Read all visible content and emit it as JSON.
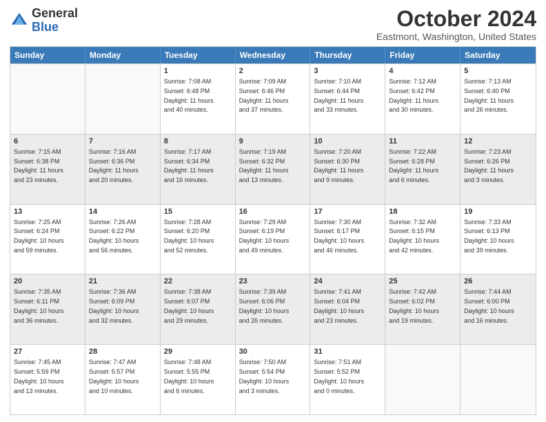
{
  "header": {
    "logo_general": "General",
    "logo_blue": "Blue",
    "title": "October 2024",
    "subtitle": "Eastmont, Washington, United States"
  },
  "days_of_week": [
    "Sunday",
    "Monday",
    "Tuesday",
    "Wednesday",
    "Thursday",
    "Friday",
    "Saturday"
  ],
  "weeks": [
    [
      {
        "day": "",
        "lines": []
      },
      {
        "day": "",
        "lines": []
      },
      {
        "day": "1",
        "lines": [
          "Sunrise: 7:08 AM",
          "Sunset: 6:48 PM",
          "Daylight: 11 hours",
          "and 40 minutes."
        ]
      },
      {
        "day": "2",
        "lines": [
          "Sunrise: 7:09 AM",
          "Sunset: 6:46 PM",
          "Daylight: 11 hours",
          "and 37 minutes."
        ]
      },
      {
        "day": "3",
        "lines": [
          "Sunrise: 7:10 AM",
          "Sunset: 6:44 PM",
          "Daylight: 11 hours",
          "and 33 minutes."
        ]
      },
      {
        "day": "4",
        "lines": [
          "Sunrise: 7:12 AM",
          "Sunset: 6:42 PM",
          "Daylight: 11 hours",
          "and 30 minutes."
        ]
      },
      {
        "day": "5",
        "lines": [
          "Sunrise: 7:13 AM",
          "Sunset: 6:40 PM",
          "Daylight: 11 hours",
          "and 26 minutes."
        ]
      }
    ],
    [
      {
        "day": "6",
        "lines": [
          "Sunrise: 7:15 AM",
          "Sunset: 6:38 PM",
          "Daylight: 11 hours",
          "and 23 minutes."
        ]
      },
      {
        "day": "7",
        "lines": [
          "Sunrise: 7:16 AM",
          "Sunset: 6:36 PM",
          "Daylight: 11 hours",
          "and 20 minutes."
        ]
      },
      {
        "day": "8",
        "lines": [
          "Sunrise: 7:17 AM",
          "Sunset: 6:34 PM",
          "Daylight: 11 hours",
          "and 16 minutes."
        ]
      },
      {
        "day": "9",
        "lines": [
          "Sunrise: 7:19 AM",
          "Sunset: 6:32 PM",
          "Daylight: 11 hours",
          "and 13 minutes."
        ]
      },
      {
        "day": "10",
        "lines": [
          "Sunrise: 7:20 AM",
          "Sunset: 6:30 PM",
          "Daylight: 11 hours",
          "and 9 minutes."
        ]
      },
      {
        "day": "11",
        "lines": [
          "Sunrise: 7:22 AM",
          "Sunset: 6:28 PM",
          "Daylight: 11 hours",
          "and 6 minutes."
        ]
      },
      {
        "day": "12",
        "lines": [
          "Sunrise: 7:23 AM",
          "Sunset: 6:26 PM",
          "Daylight: 11 hours",
          "and 3 minutes."
        ]
      }
    ],
    [
      {
        "day": "13",
        "lines": [
          "Sunrise: 7:25 AM",
          "Sunset: 6:24 PM",
          "Daylight: 10 hours",
          "and 59 minutes."
        ]
      },
      {
        "day": "14",
        "lines": [
          "Sunrise: 7:26 AM",
          "Sunset: 6:22 PM",
          "Daylight: 10 hours",
          "and 56 minutes."
        ]
      },
      {
        "day": "15",
        "lines": [
          "Sunrise: 7:28 AM",
          "Sunset: 6:20 PM",
          "Daylight: 10 hours",
          "and 52 minutes."
        ]
      },
      {
        "day": "16",
        "lines": [
          "Sunrise: 7:29 AM",
          "Sunset: 6:19 PM",
          "Daylight: 10 hours",
          "and 49 minutes."
        ]
      },
      {
        "day": "17",
        "lines": [
          "Sunrise: 7:30 AM",
          "Sunset: 6:17 PM",
          "Daylight: 10 hours",
          "and 46 minutes."
        ]
      },
      {
        "day": "18",
        "lines": [
          "Sunrise: 7:32 AM",
          "Sunset: 6:15 PM",
          "Daylight: 10 hours",
          "and 42 minutes."
        ]
      },
      {
        "day": "19",
        "lines": [
          "Sunrise: 7:33 AM",
          "Sunset: 6:13 PM",
          "Daylight: 10 hours",
          "and 39 minutes."
        ]
      }
    ],
    [
      {
        "day": "20",
        "lines": [
          "Sunrise: 7:35 AM",
          "Sunset: 6:11 PM",
          "Daylight: 10 hours",
          "and 36 minutes."
        ]
      },
      {
        "day": "21",
        "lines": [
          "Sunrise: 7:36 AM",
          "Sunset: 6:09 PM",
          "Daylight: 10 hours",
          "and 32 minutes."
        ]
      },
      {
        "day": "22",
        "lines": [
          "Sunrise: 7:38 AM",
          "Sunset: 6:07 PM",
          "Daylight: 10 hours",
          "and 29 minutes."
        ]
      },
      {
        "day": "23",
        "lines": [
          "Sunrise: 7:39 AM",
          "Sunset: 6:06 PM",
          "Daylight: 10 hours",
          "and 26 minutes."
        ]
      },
      {
        "day": "24",
        "lines": [
          "Sunrise: 7:41 AM",
          "Sunset: 6:04 PM",
          "Daylight: 10 hours",
          "and 23 minutes."
        ]
      },
      {
        "day": "25",
        "lines": [
          "Sunrise: 7:42 AM",
          "Sunset: 6:02 PM",
          "Daylight: 10 hours",
          "and 19 minutes."
        ]
      },
      {
        "day": "26",
        "lines": [
          "Sunrise: 7:44 AM",
          "Sunset: 6:00 PM",
          "Daylight: 10 hours",
          "and 16 minutes."
        ]
      }
    ],
    [
      {
        "day": "27",
        "lines": [
          "Sunrise: 7:45 AM",
          "Sunset: 5:59 PM",
          "Daylight: 10 hours",
          "and 13 minutes."
        ]
      },
      {
        "day": "28",
        "lines": [
          "Sunrise: 7:47 AM",
          "Sunset: 5:57 PM",
          "Daylight: 10 hours",
          "and 10 minutes."
        ]
      },
      {
        "day": "29",
        "lines": [
          "Sunrise: 7:48 AM",
          "Sunset: 5:55 PM",
          "Daylight: 10 hours",
          "and 6 minutes."
        ]
      },
      {
        "day": "30",
        "lines": [
          "Sunrise: 7:50 AM",
          "Sunset: 5:54 PM",
          "Daylight: 10 hours",
          "and 3 minutes."
        ]
      },
      {
        "day": "31",
        "lines": [
          "Sunrise: 7:51 AM",
          "Sunset: 5:52 PM",
          "Daylight: 10 hours",
          "and 0 minutes."
        ]
      },
      {
        "day": "",
        "lines": []
      },
      {
        "day": "",
        "lines": []
      }
    ]
  ]
}
